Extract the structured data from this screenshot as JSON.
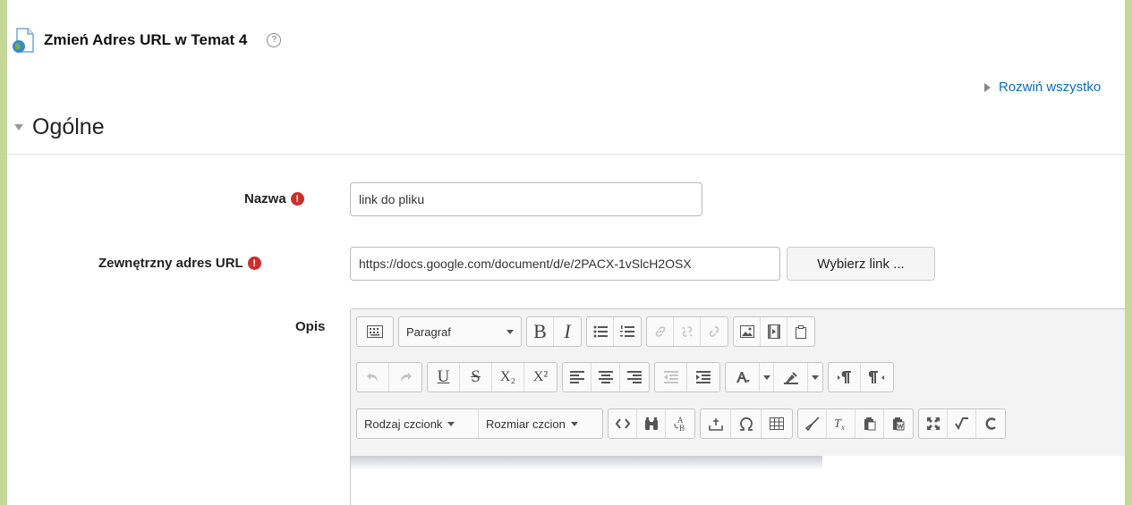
{
  "header": {
    "title": "Zmień Adres URL w Temat 4",
    "icon": "url-resource-icon",
    "help_icon": "help-icon",
    "help_glyph": "?"
  },
  "expand_all": {
    "label": "Rozwiń wszystko"
  },
  "section": {
    "title": "Ogólne"
  },
  "fields": {
    "name": {
      "label": "Nazwa",
      "value": "link do pliku",
      "required_glyph": "!"
    },
    "external_url": {
      "label": "Zewnętrzny adres URL",
      "value": "https://docs.google.com/document/d/e/2PACX-1vSlcH2OSX",
      "required_glyph": "!",
      "choose_button": "Wybierz link ..."
    },
    "description": {
      "label": "Opis"
    }
  },
  "editor": {
    "row1": {
      "toggle_icon": "toolbar-toggle-icon",
      "format_select": "Paragraf",
      "bold": "B",
      "italic": "I",
      "list_icons": [
        "bullet-list-icon",
        "numbered-list-icon"
      ],
      "link_icons": [
        "link-icon",
        "unlink-icon",
        "anchor-icon"
      ],
      "media_icons": [
        "image-icon",
        "media-icon",
        "paste-icon"
      ]
    },
    "row2": {
      "undo_icons": [
        "undo-icon",
        "redo-icon"
      ],
      "underline": "U",
      "strike": "S",
      "subscript": "X₂",
      "superscript": "X²",
      "align_icons": [
        "align-left-icon",
        "align-center-icon",
        "align-right-icon"
      ],
      "indent_icons": [
        "outdent-icon",
        "indent-icon"
      ],
      "text_color_icon": "font-color-icon",
      "bg_color_icon": "background-color-icon",
      "direction_icons": [
        "ltr-icon",
        "rtl-icon"
      ]
    },
    "row3": {
      "font_family": "Rodzaj czcionk",
      "font_size": "Rozmiar czcion",
      "tools": [
        "code-icon",
        "find-icon",
        "replace-icon",
        "anchor-insert-icon",
        "omega-icon",
        "table-icon",
        "clean-icon",
        "clear-format-icon",
        "paste-text-icon",
        "paste-word-icon",
        "fullscreen-icon",
        "equation-icon",
        "c-icon"
      ]
    }
  },
  "colors": {
    "frame": "#c5d89a",
    "link": "#0a6cb5",
    "required": "#c9302c"
  }
}
